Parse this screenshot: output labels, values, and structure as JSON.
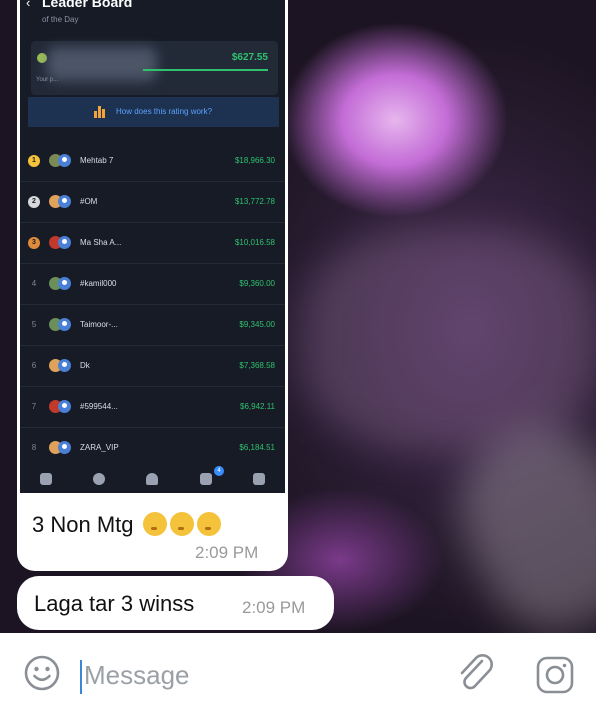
{
  "colors": {
    "accent": "#2fc26d",
    "link": "#5ba3ff",
    "input_caret": "#3b87d6"
  },
  "screenshot": {
    "back_icon": "back-arrow-icon",
    "title": "Leader Board",
    "subtitle": "of the Day",
    "your_amount": "$627.55",
    "your_label": "Your p...",
    "rating_link": "How does this rating work?",
    "rows": [
      {
        "rank": "1",
        "name": "Mehtab 7",
        "amount": "$18,966.30",
        "medal": "#f5c33b",
        "av": "#7b8a55"
      },
      {
        "rank": "2",
        "name": "#OM",
        "amount": "$13,772.78",
        "medal": "#d6d8dc",
        "av": "#e0a25a"
      },
      {
        "rank": "3",
        "name": "Ma Sha A...",
        "amount": "$10,016.58",
        "medal": "#e08a3c",
        "av": "#c0392b"
      },
      {
        "rank": "4",
        "name": "#kamil000",
        "amount": "$9,360.00",
        "medal": "",
        "av": "#6a8f5a"
      },
      {
        "rank": "5",
        "name": "Taimoor-...",
        "amount": "$9,345.00",
        "medal": "",
        "av": "#6a8f5a"
      },
      {
        "rank": "6",
        "name": "Dk",
        "amount": "$7,368.58",
        "medal": "",
        "av": "#e0a25a"
      },
      {
        "rank": "7",
        "name": "#599544...",
        "amount": "$6,942.11",
        "medal": "",
        "av": "#c0392b"
      },
      {
        "rank": "8",
        "name": "ZARA_VIP",
        "amount": "$6,184.51",
        "medal": "",
        "av": "#e0a25a"
      }
    ],
    "tab_badge": "4",
    "tabs": [
      "gallery-icon",
      "help-icon",
      "profile-icon",
      "trophy-icon",
      "chat-icon"
    ]
  },
  "messages": [
    {
      "text": "3 Non Mtg",
      "emojis": [
        "weary-face-icon",
        "kissing-face-icon",
        "kissing-face-icon"
      ],
      "time": "2:09 PM"
    },
    {
      "text": "Laga tar 3 winss",
      "time": "2:09 PM"
    }
  ],
  "composer": {
    "placeholder": "Message",
    "icons": [
      "smile-icon",
      "paperclip-icon",
      "camera-icon"
    ]
  }
}
